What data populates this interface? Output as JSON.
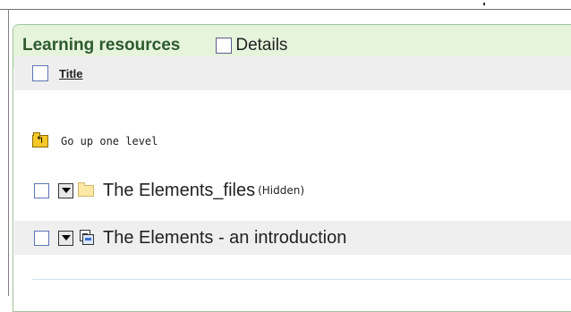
{
  "panel": {
    "title": "Learning resources",
    "details_label": "Details"
  },
  "table": {
    "column_title": "Title",
    "go_up_label": "Go up one level",
    "rows": [
      {
        "name": "The Elements_files",
        "tag": "(Hidden)",
        "icon": "folder-icon"
      },
      {
        "name": "The Elements - an introduction",
        "tag": "",
        "icon": "document-icon"
      }
    ]
  },
  "colors": {
    "header_bg": "#e6f4dc",
    "header_border": "#9fc59a",
    "title_color": "#2d5a2d",
    "row_alt_bg": "#efefef"
  }
}
